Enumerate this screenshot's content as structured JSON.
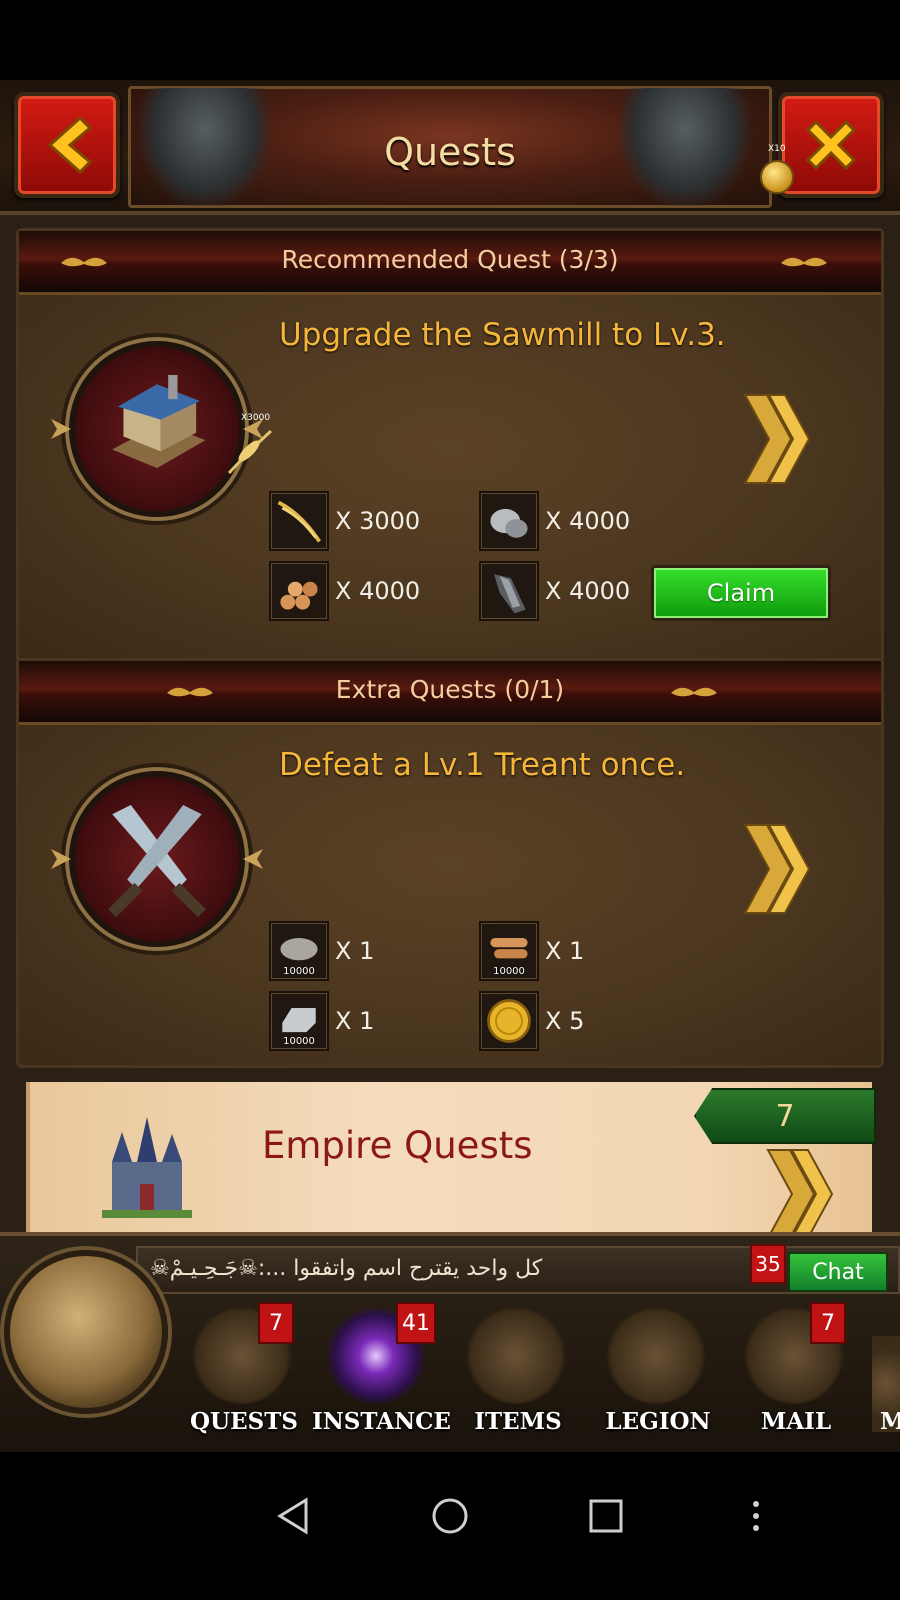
{
  "header": {
    "title": "Quests",
    "coin_multiplier": "X10"
  },
  "recommended": {
    "section_title": "Recommended Quest (3/3)",
    "badge_multiplier": "X3000",
    "quest_text": "Upgrade the Sawmill to Lv.3.",
    "rewards": [
      {
        "icon": "wheat-icon",
        "qty": "X 3000"
      },
      {
        "icon": "stone-icon",
        "qty": "X 4000"
      },
      {
        "icon": "wood-icon",
        "qty": "X 4000"
      },
      {
        "icon": "ore-icon",
        "qty": "X 4000"
      }
    ],
    "claim_label": "Claim"
  },
  "extra": {
    "section_title": "Extra Quests (0/1)",
    "quest_text": "Defeat a Lv.1 Treant once.",
    "rewards": [
      {
        "icon": "stone-pack-icon",
        "qty": "X 1",
        "sub": "10000"
      },
      {
        "icon": "wood-pack-icon",
        "qty": "X 1",
        "sub": "10000"
      },
      {
        "icon": "iron-pack-icon",
        "qty": "X 1",
        "sub": "10000"
      },
      {
        "icon": "gold-coin-icon",
        "qty": "X 5",
        "sub": ""
      }
    ]
  },
  "empire": {
    "title": "Empire Quests",
    "count": "7"
  },
  "bottom_bar": {
    "chat_message": "كل واحد يقترح اسم واتفقوا ...:☠جَـحِـيـمْ☠",
    "chat_badge": "35",
    "chat_label": "Chat",
    "tabs": [
      {
        "label": "QUESTS",
        "badge": "7"
      },
      {
        "label": "INSTANCE",
        "badge": "41"
      },
      {
        "label": "ITEMS",
        "badge": ""
      },
      {
        "label": "LEGION",
        "badge": ""
      },
      {
        "label": "MAIL",
        "badge": "7"
      }
    ],
    "more_label": "M"
  },
  "colors": {
    "accent_gold": "#f5b63a",
    "claim_green": "#1bbf17",
    "badge_red": "#c01414",
    "empire_red": "#8c1717"
  }
}
